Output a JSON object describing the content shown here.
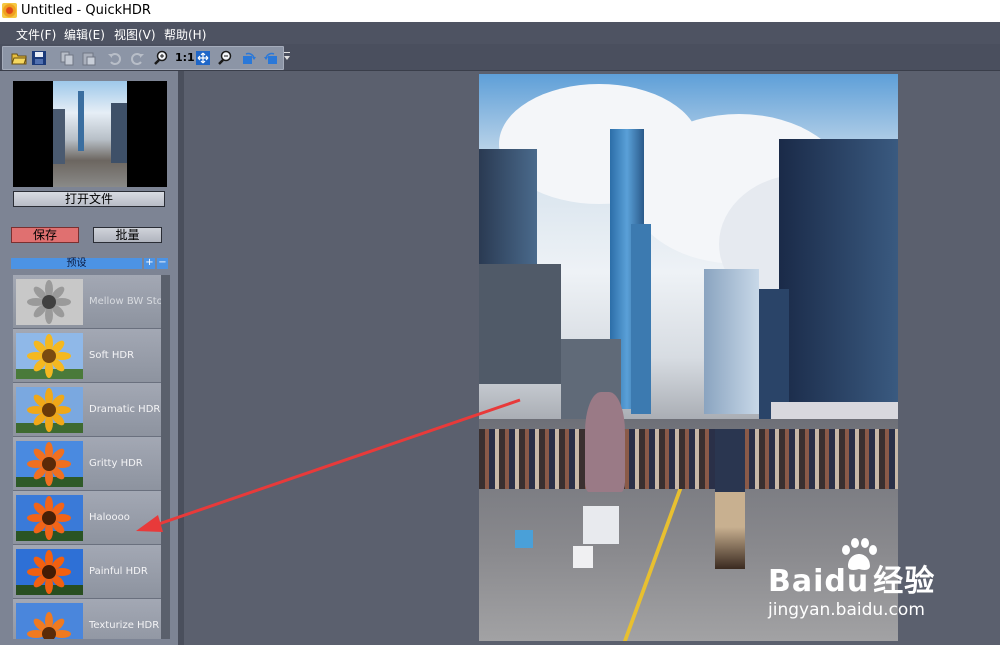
{
  "window": {
    "title": "Untitled - QuickHDR"
  },
  "menu": [
    {
      "label": "文件(F)"
    },
    {
      "label": "编辑(E)"
    },
    {
      "label": "视图(V)"
    },
    {
      "label": "帮助(H)"
    }
  ],
  "toolbar": {
    "actual_size_label": "1:1"
  },
  "sidebar": {
    "open_button": "打开文件",
    "save_button": "保存",
    "batch_button": "批量",
    "presets_title": "预设",
    "add_symbol": "+",
    "remove_symbol": "−",
    "presets": [
      {
        "label": "Mellow BW Stoc"
      },
      {
        "label": "Soft HDR"
      },
      {
        "label": "Dramatic HDR"
      },
      {
        "label": "Gritty HDR"
      },
      {
        "label": "Haloooo"
      },
      {
        "label": "Painful HDR"
      },
      {
        "label": "Texturize HDR"
      }
    ]
  },
  "watermark": {
    "brand_a": "Bai",
    "brand_b": "du",
    "brand_c": "经验",
    "url": "jingyan.baidu.com"
  },
  "colors": {
    "accent": "#4c93e4",
    "save": "#e07070",
    "arrow": "#e83a3a",
    "panel": "#7d8494"
  }
}
